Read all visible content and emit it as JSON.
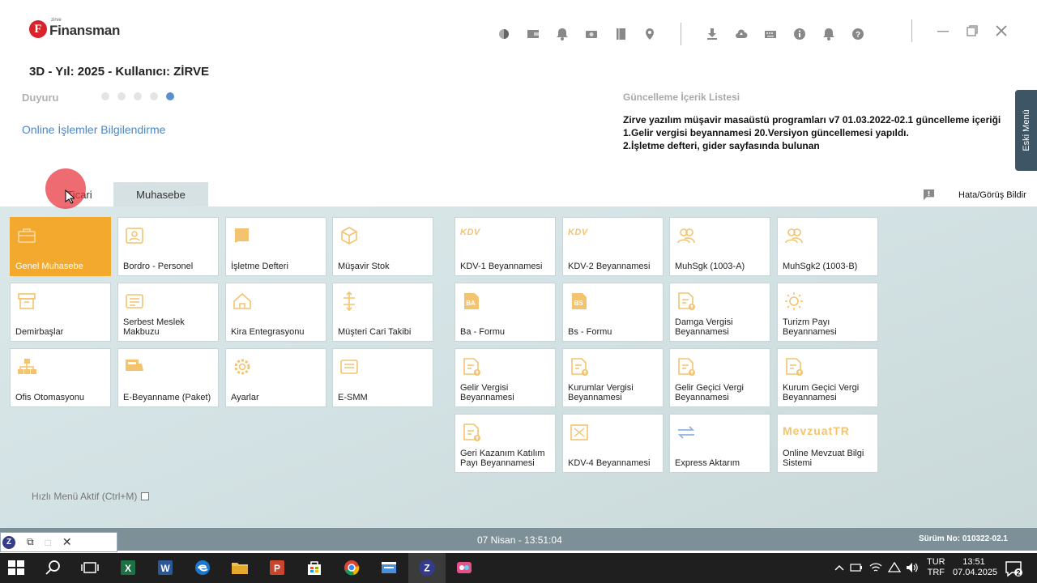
{
  "logo": {
    "mark": "F",
    "brand": "Finansman",
    "sub": "zirve"
  },
  "header": {
    "title": "3D - Yıl: 2025 - Kullanıcı: ZİRVE"
  },
  "announcement": {
    "label": "Duyuru",
    "dot_count": 5,
    "active_dot": 5
  },
  "online_link": "Online İşlemler Bilgilendirme",
  "update_list": {
    "title": "Güncelleme İçerik Listesi",
    "lines": [
      "Zirve yazılım müşavir masaüstü programları v7 01.03.2022-02.1 güncelleme içeriği",
      "1.Gelir vergisi beyannamesi 20.Versiyon güncellemesi yapıldı.",
      "2.İşletme defteri, gider sayfasında bulunan"
    ]
  },
  "side_menu": {
    "label": "Eski Menü"
  },
  "tabs": [
    {
      "label": "Ticari",
      "active": false
    },
    {
      "label": "Muhasebe",
      "active": true
    }
  ],
  "report": {
    "label": "Hata/Görüş Bildir"
  },
  "left_tiles": [
    {
      "label": "Genel Muhasebe",
      "icon": "briefcase-icon",
      "highlight": true
    },
    {
      "label": "Bordro - Personel",
      "icon": "id-card-icon"
    },
    {
      "label": "İşletme Defteri",
      "icon": "book-icon"
    },
    {
      "label": "Müşavir Stok",
      "icon": "box-icon"
    },
    {
      "label": "Demirbaşlar",
      "icon": "archive-icon"
    },
    {
      "label": "Serbest Meslek Makbuzu",
      "icon": "receipt-icon"
    },
    {
      "label": "Kira Entegrasyonu",
      "icon": "house-icon"
    },
    {
      "label": "Müşteri Cari Takibi",
      "icon": "sort-icon"
    },
    {
      "label": "Ofis Otomasyonu",
      "icon": "org-chart-icon"
    },
    {
      "label": "E-Beyanname (Paket)",
      "icon": "package-icon"
    },
    {
      "label": "Ayarlar",
      "icon": "gear-icon"
    },
    {
      "label": "E-SMM",
      "icon": "receipt-icon"
    }
  ],
  "right_tiles": [
    {
      "label": "KDV-1 Beyannamesi",
      "wordmark": "KDV"
    },
    {
      "label": "KDV-2 Beyannamesi",
      "wordmark": "KDV"
    },
    {
      "label": "MuhSgk (1003-A)",
      "icon": "users-icon"
    },
    {
      "label": "MuhSgk2 (1003-B)",
      "icon": "users-icon"
    },
    {
      "label": "Ba - Formu",
      "icon": "ba-form-icon"
    },
    {
      "label": "Bs - Formu",
      "icon": "bs-form-icon"
    },
    {
      "label": "Damga Vergisi Beyannamesi",
      "icon": "doc-upload-icon"
    },
    {
      "label": "Turizm Payı Beyannamesi",
      "icon": "sun-icon"
    },
    {
      "label": "Gelir Vergisi Beyannamesi",
      "icon": "doc-upload-icon"
    },
    {
      "label": "Kurumlar Vergisi Beyannamesi",
      "icon": "doc-upload-icon"
    },
    {
      "label": "Gelir Geçici Vergi Beyannamesi",
      "icon": "doc-upload-icon"
    },
    {
      "label": "Kurum Geçici Vergi Beyannamesi",
      "icon": "doc-upload-icon"
    },
    {
      "label": "Geri Kazanım Katılım Payı Beyannamesi",
      "icon": "doc-upload-icon"
    },
    {
      "label": "KDV-4 Beyannamesi",
      "icon": "kdv4-icon"
    },
    {
      "label": "Express Aktarım",
      "icon": "transfer-icon"
    },
    {
      "label": "Online Mevzuat Bilgi Sistemi",
      "wordmark": "MevzuatTR"
    }
  ],
  "quick_menu": {
    "label": "Hızlı Menü Aktif (Ctrl+M)",
    "checked": false
  },
  "status": {
    "date": "07 Nisan - 13:51:04",
    "version": "Sürüm No: 010322-02.1"
  },
  "taskbar": {
    "lang_line1": "TUR",
    "lang_line2": "TRF",
    "time": "13:51",
    "date": "07.04.2025",
    "notifications": "2"
  },
  "colors": {
    "accent": "#f3a82e",
    "icon_tint": "#f4c36f",
    "status_bar": "#7d9098",
    "link": "#4a86c5"
  }
}
